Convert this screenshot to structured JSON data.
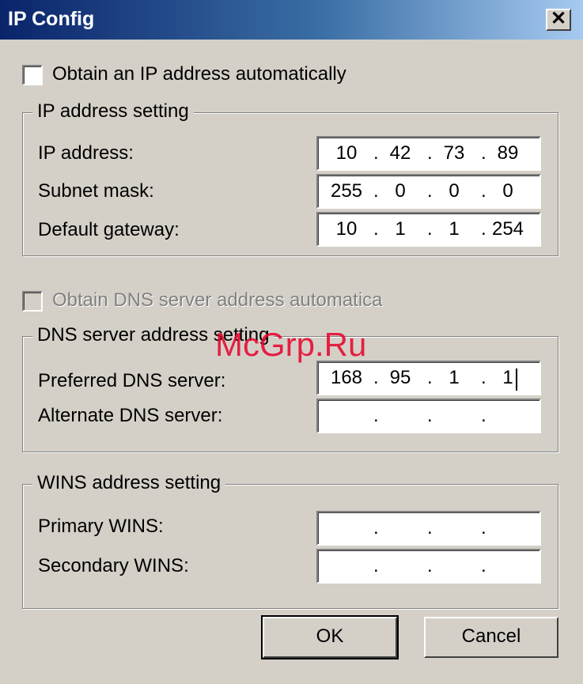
{
  "window": {
    "title": "IP Config",
    "close_glyph": "✕"
  },
  "obtain_ip_auto": {
    "label": "Obtain an IP address automatically",
    "checked": false
  },
  "ip_group": {
    "title": "IP address setting",
    "ip_label": "IP address:",
    "ip": [
      "10",
      "42",
      "73",
      "89"
    ],
    "mask_label": "Subnet mask:",
    "mask": [
      "255",
      "0",
      "0",
      "0"
    ],
    "gateway_label": "Default gateway:",
    "gateway": [
      "10",
      "1",
      "1",
      "254"
    ]
  },
  "obtain_dns_auto": {
    "label": "Obtain DNS server address automatica",
    "checked": false,
    "enabled": false
  },
  "dns_group": {
    "title": "DNS server address setting",
    "preferred_label": "Preferred DNS server:",
    "preferred": [
      "168",
      "95",
      "1",
      "1"
    ],
    "alternate_label": "Alternate DNS server:",
    "alternate": [
      "",
      "",
      "",
      ""
    ]
  },
  "wins_group": {
    "title": "WINS address setting",
    "primary_label": "Primary WINS:",
    "primary": [
      "",
      "",
      "",
      ""
    ],
    "secondary_label": "Secondary WINS:",
    "secondary": [
      "",
      "",
      "",
      ""
    ]
  },
  "buttons": {
    "ok": "OK",
    "cancel": "Cancel"
  },
  "watermark": "McGrp.Ru",
  "ip_separator": ".",
  "colors": {
    "title_gradient_start": "#0a246a",
    "title_gradient_end": "#a6caf0",
    "face": "#d4d0c8",
    "watermark": "#e8002a"
  }
}
